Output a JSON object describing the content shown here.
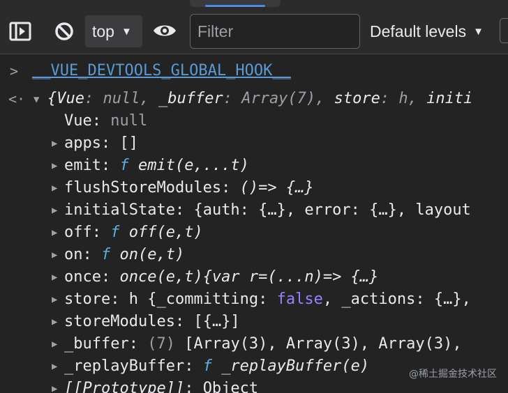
{
  "toolbar": {
    "context": "top",
    "filter_placeholder": "Filter",
    "levels": "Default levels",
    "caret": "▼"
  },
  "console": {
    "command": "__VUE_DEVTOOLS_GLOBAL_HOOK__",
    "summary": {
      "prefix": "{",
      "p1_key": "Vue",
      "p1_val": "null",
      "p2_key": "_buffer",
      "p2_val": "Array(7)",
      "p3_key": "store",
      "p3_val": "h",
      "p4_key": "initi"
    },
    "props": [
      {
        "key": "Vue",
        "val": "null"
      },
      {
        "key": "apps",
        "val": "[]"
      },
      {
        "key": "emit",
        "f": "f",
        "val": "emit(e,...t)"
      },
      {
        "key": "flushStoreModules",
        "val": "()=> {…}"
      },
      {
        "key": "initialState",
        "val": "{auth: {…}, error: {…}, layout"
      },
      {
        "key": "off",
        "f": "f",
        "val": "off(e,t)"
      },
      {
        "key": "on",
        "f": "f",
        "val": "on(e,t)"
      },
      {
        "key": "once",
        "val": "once(e,t){var r=(...n)=> {…}"
      },
      {
        "key": "store",
        "pre": "h {_committing: ",
        "bool": "false",
        "post": ", _actions: {…},"
      },
      {
        "key": "storeModules",
        "val": "[{…}]"
      },
      {
        "key": "_buffer",
        "count": "(7)",
        "val": "[Array(3), Array(3), Array(3),"
      },
      {
        "key": "_replayBuffer",
        "f": "f",
        "val": "_replayBuffer(e)"
      },
      {
        "key": "[[Prototype]]",
        "val": "Object"
      }
    ],
    "watermark": "@稀土掘金技术社区"
  }
}
